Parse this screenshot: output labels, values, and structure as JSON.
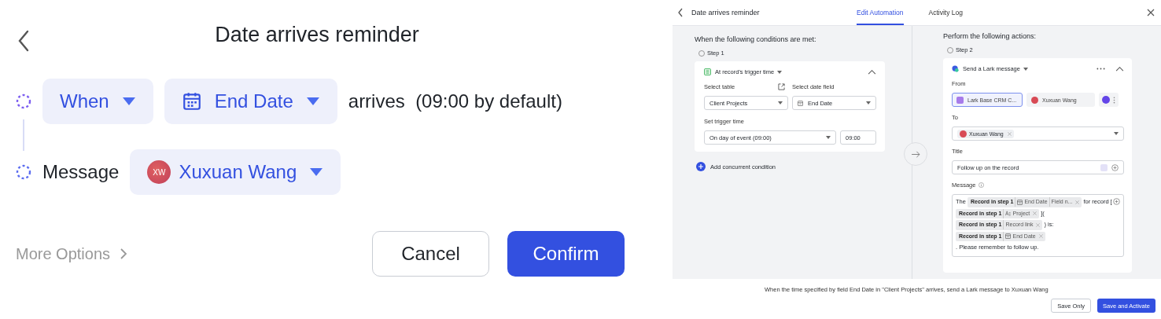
{
  "editor": {
    "title": "Date arrives reminder",
    "trigger": {
      "condition": "When",
      "field": "End Date",
      "suffix": "arrives  (09:00 by default)"
    },
    "action": {
      "label": "Message",
      "recipient": {
        "initials": "XW",
        "name": "Xuxuan Wang"
      }
    },
    "more_options": "More Options",
    "buttons": [
      {
        "label": "Cancel",
        "kind": "secondary"
      },
      {
        "label": "Confirm",
        "kind": "primary"
      }
    ]
  },
  "automation": {
    "title": "Date arrives reminder",
    "tabs": [
      {
        "label": "Edit Automation",
        "selected": true
      },
      {
        "label": "Activity Log",
        "selected": false
      }
    ],
    "conditions": {
      "heading": "When the following conditions are met:",
      "step": "Step 1",
      "trigger": "At record's trigger time",
      "table_label": "Select table",
      "table": "Client Projects",
      "date_label": "Select date field",
      "date_field": "End Date",
      "time_label": "Set trigger time",
      "time_option": "On day of event (09:00)",
      "time": "09:00",
      "add": "Add concurrent condition"
    },
    "actions": {
      "heading": "Perform the following actions:",
      "step": "Step 2",
      "action": "Send a Lark message",
      "from_label": "From",
      "from": [
        {
          "name": "Lark Base CRM C...",
          "kind": "bot",
          "selected": true
        },
        {
          "name": "Xuxuan Wang",
          "kind": "user",
          "selected": false
        }
      ],
      "to_label": "To",
      "to": [
        {
          "name": "Xuxuan Wang"
        }
      ],
      "title_label": "Title",
      "title": "Follow up on the record",
      "message_label": "Message",
      "message": [
        {
          "kind": "text",
          "text": "The"
        },
        {
          "kind": "chip",
          "parts": [
            {
              "kind": "record",
              "text": "Record in step 1"
            },
            {
              "kind": "date",
              "text": "End Date"
            },
            {
              "kind": "plain",
              "text": "Field n..."
            }
          ]
        },
        {
          "kind": "text",
          "text": "for record"
        },
        {
          "kind": "text",
          "text": "["
        },
        {
          "kind": "chip",
          "parts": [
            {
              "kind": "record",
              "text": "Record in step 1"
            },
            {
              "kind": "text",
              "text": "Project"
            }
          ]
        },
        {
          "kind": "text",
          "text": "]("
        },
        {
          "kind": "chip",
          "parts": [
            {
              "kind": "record",
              "text": "Record in step 1"
            },
            {
              "kind": "plain",
              "text": "Record link"
            }
          ]
        },
        {
          "kind": "text",
          "text": ") is:"
        },
        {
          "kind": "chip",
          "parts": [
            {
              "kind": "record",
              "text": "Record in step 1"
            },
            {
              "kind": "date",
              "text": "End Date"
            }
          ]
        },
        {
          "kind": "text",
          "text": ". Please remember to follow up."
        }
      ]
    },
    "summary": "When the time specified by field End Date in \"Client Projects\" arrives, send a Lark message to Xuxuan Wang",
    "buttons": [
      {
        "label": "Save Only",
        "kind": "secondary"
      },
      {
        "label": "Save and Activate",
        "kind": "primary"
      }
    ]
  }
}
